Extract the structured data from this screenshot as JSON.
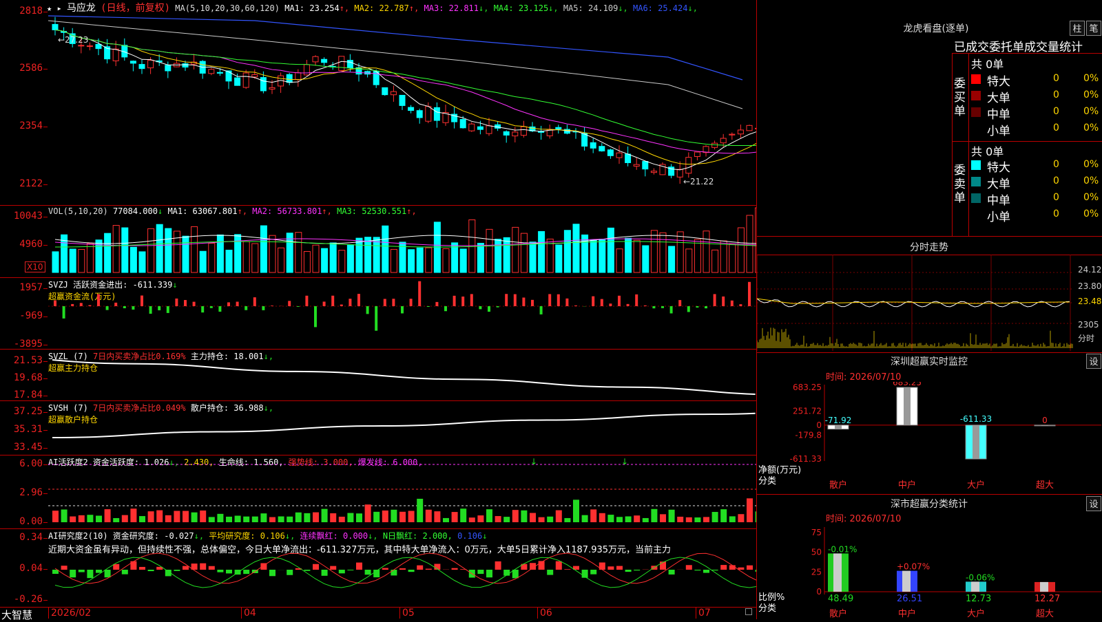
{
  "stock": {
    "name": "马应龙",
    "period": "(日线，前复权)",
    "ma_def": "MA(5,10,20,30,60,120)"
  },
  "price_axis": {
    "labels": [
      "2818",
      "2586",
      "2354",
      "2122"
    ],
    "high_mark": "←27.23",
    "low_mark": "←21.22"
  },
  "ma_header": [
    {
      "label": "MA1: 23.254",
      "color": "#ffffff",
      "arrow": "↑",
      "acolor": "#ff3030"
    },
    {
      "label": "MA2: 22.787",
      "color": "#ffd700",
      "arrow": "↑",
      "acolor": "#ff3030"
    },
    {
      "label": "MA3: 22.811",
      "color": "#ff33ff",
      "arrow": "↓",
      "acolor": "#22dd22"
    },
    {
      "label": "MA4: 23.125",
      "color": "#33ff33",
      "arrow": "↓",
      "acolor": "#22dd22"
    },
    {
      "label": "MA5: 24.109",
      "color": "#cccccc",
      "arrow": "↓",
      "acolor": "#22dd22"
    },
    {
      "label": "MA6: 25.424",
      "color": "#3355ff",
      "arrow": "↓",
      "acolor": "#22dd22"
    }
  ],
  "vol": {
    "axis": [
      "10043",
      "4960"
    ],
    "unit": "X10",
    "title": "VOL(5,10,20)",
    "value": "77084.000",
    "arrow": "↓",
    "ma": [
      {
        "label": "MA1: 63067.801",
        "color": "#ffffff",
        "arrow": "↑"
      },
      {
        "label": "MA2: 56733.801",
        "color": "#ff33ff",
        "arrow": "↑"
      },
      {
        "label": "MA3: 52530.551",
        "color": "#33ff33",
        "arrow": "↑"
      }
    ]
  },
  "svzj": {
    "axis": [
      "1957",
      "-969",
      "-3895"
    ],
    "title": "SVZJ  活跃资金进出: -611.339",
    "arrow": "↓",
    "sub": "超赢资金流(万元)"
  },
  "svzl": {
    "axis": [
      "21.53",
      "19.68",
      "17.84"
    ],
    "title": "SVZL (7) ",
    "red": "7日内买卖净占比0.169%",
    "rest": " 主力持仓: 18.001",
    "arrow": "↓,",
    "sub": "超赢主力持仓"
  },
  "svsh": {
    "axis": [
      "37.25",
      "35.31",
      "33.45"
    ],
    "title": "SVSH (7) ",
    "red": "7日内买卖净占比0.049%",
    "rest": " 散户持仓: 36.988",
    "arrow": "↓,",
    "sub": "超赢散户持仓"
  },
  "ai1": {
    "axis": [
      "6.00",
      "2.96",
      "0.00"
    ],
    "t1": "AI活跃度2 资金活跃度: 1.026",
    "t1a": "↓,",
    "t2": " 2.430,",
    "t3": " 生命线: 1.560,",
    "t4": " 强势线: 3.000,",
    "t5": " 爆发线: 6.000,"
  },
  "ai2": {
    "axis": [
      "0.34",
      "0.04",
      "-0.26"
    ],
    "t1": "AI研究度2(10) 资金研究度: -0.027",
    "t1a": "↓,",
    "t2": " 平均研究度: 0.106",
    "t2a": "↓,",
    "t3": " 连续飘红: 0.000",
    "t3a": "↓,",
    "t4": " N日飘红: 2.000,",
    "t5": " 0.106",
    "t5a": "↓",
    "comment": "近期大资金虽有异动，但持续性不强，总体偏空，今日大单净流出：-611.327万元，其中特大单净流入：0万元，大单5日累计净入1187.935万元，当前主力"
  },
  "xaxis": {
    "labels": [
      "2026/02",
      "04",
      "05",
      "06",
      "07"
    ],
    "brand": "大智慧"
  },
  "lhb": {
    "title": "龙虎看盘(逐单)",
    "btn1": "柱",
    "btn2": "笔",
    "tabs": "已成交委托单成交量统计",
    "buy": {
      "side": "委买单",
      "total": "共 0单",
      "rows": [
        {
          "k": "特大",
          "v": "0",
          "p": "0%",
          "c": "#ff0000"
        },
        {
          "k": "大单",
          "v": "0",
          "p": "0%",
          "c": "#990000"
        },
        {
          "k": "中单",
          "v": "0",
          "p": "0%",
          "c": "#660000"
        },
        {
          "k": "小单",
          "v": "0",
          "p": "0%",
          "c": "#000000"
        }
      ]
    },
    "sell": {
      "side": "委卖单",
      "total": "共 0单",
      "rows": [
        {
          "k": "特大",
          "v": "0",
          "p": "0%",
          "c": "#00ffff"
        },
        {
          "k": "大单",
          "v": "0",
          "p": "0%",
          "c": "#008888"
        },
        {
          "k": "中单",
          "v": "0",
          "p": "0%",
          "c": "#006666"
        },
        {
          "k": "小单",
          "v": "0",
          "p": "0%",
          "c": "#000000"
        }
      ]
    }
  },
  "fenshi": {
    "title": "分时走势",
    "axis": [
      "24.12",
      "23.80",
      "23.48",
      "2305"
    ],
    "unit": "分时"
  },
  "sz_monitor": {
    "title": "深圳超赢实时监控",
    "set": "设",
    "time": "时间: 2026/07/10",
    "axis": [
      "683.25",
      "251.72",
      "0",
      "-179.8",
      "-611.33"
    ],
    "ylab": "净额(万元)",
    "xcat": "分类",
    "cats": [
      {
        "name": "散户",
        "value": -71.92,
        "label": "-71.92"
      },
      {
        "name": "中户",
        "value": 683.25,
        "label": "683.25"
      },
      {
        "name": "大户",
        "value": -611.33,
        "label": "-611.33"
      },
      {
        "name": "超大",
        "value": 0,
        "label": "0"
      }
    ]
  },
  "sz_class": {
    "title": "深市超赢分类统计",
    "set": "设",
    "time": "时间: 2026/07/10",
    "axis": [
      "75",
      "50",
      "25",
      "0"
    ],
    "ylab": "比例%",
    "xcat": "分类",
    "cats": [
      {
        "name": "散户",
        "value": 48.49,
        "label": "48.49",
        "chg": "-0.01%",
        "color": "#22cc22"
      },
      {
        "name": "中户",
        "value": 26.51,
        "label": "26.51",
        "chg": "+0.07%",
        "color": "#3344ff"
      },
      {
        "name": "大户",
        "value": 12.73,
        "label": "12.73",
        "chg": "-0.06%",
        "color": "#22cccc"
      },
      {
        "name": "超大",
        "value": 12.27,
        "label": "12.27",
        "chg": "",
        "color": "#dd2222"
      }
    ]
  }
}
